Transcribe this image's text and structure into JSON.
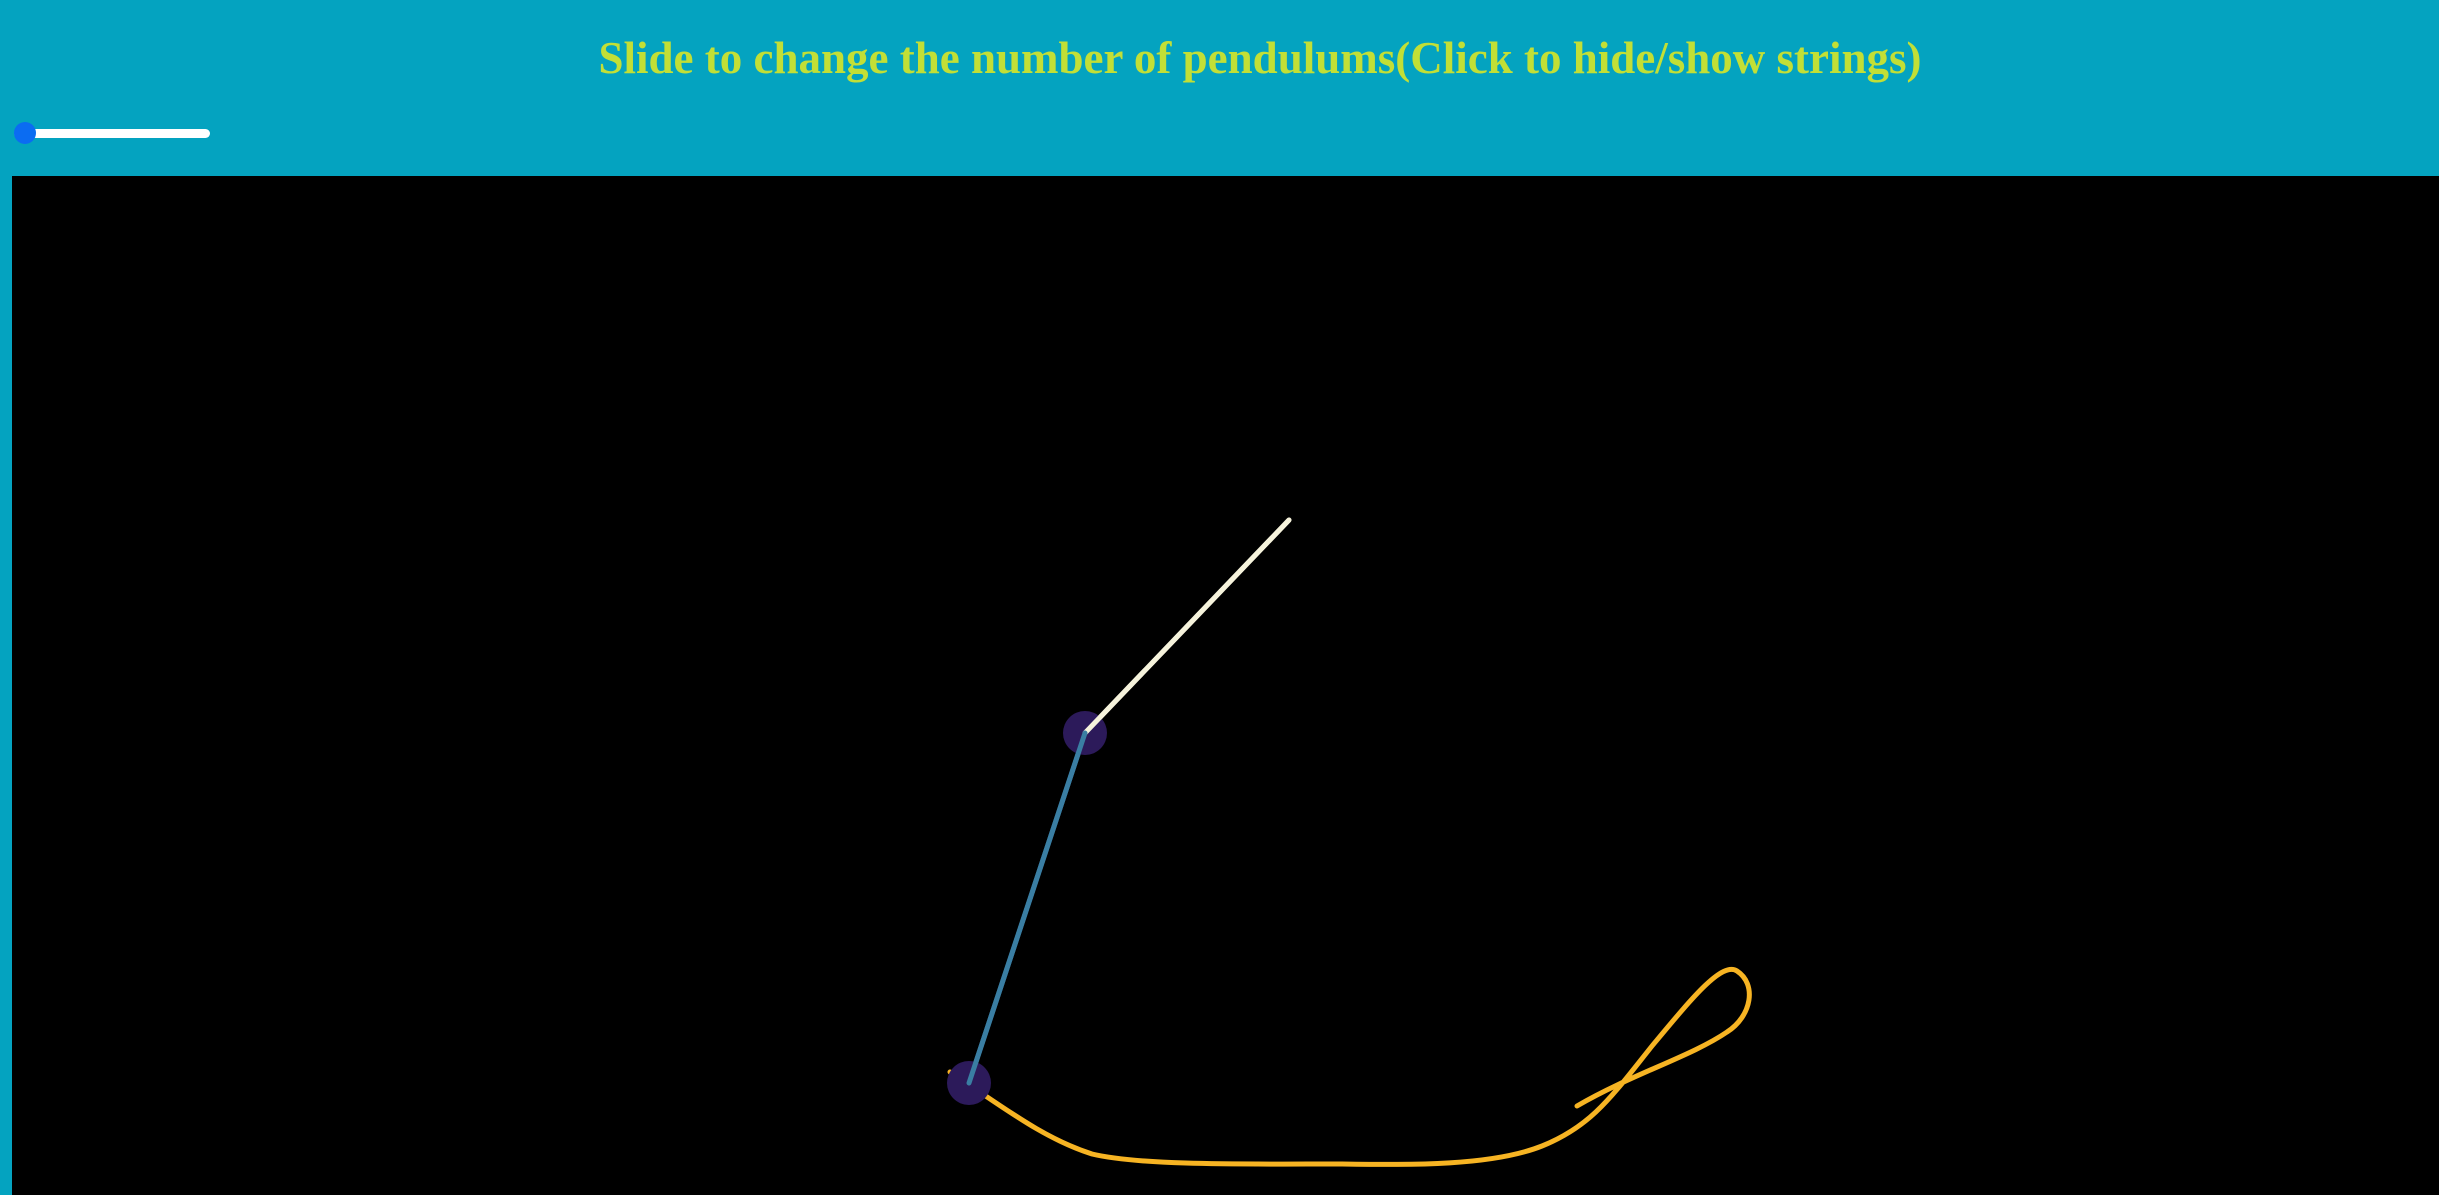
{
  "header": {
    "title": "Slide to change the number of pendulums(Click to hide/show strings)"
  },
  "slider": {
    "value_fraction": 0.0
  },
  "colors": {
    "background": "#04a3c0",
    "title": "#c2df36",
    "slider_track": "#ffffff",
    "slider_accent": "#0b6cf2",
    "canvas": "#000000",
    "string_1": "#f6f3dc",
    "string_2": "#3a7ea3",
    "bob": "#2c1a5a",
    "trace": "#f7b423"
  }
}
